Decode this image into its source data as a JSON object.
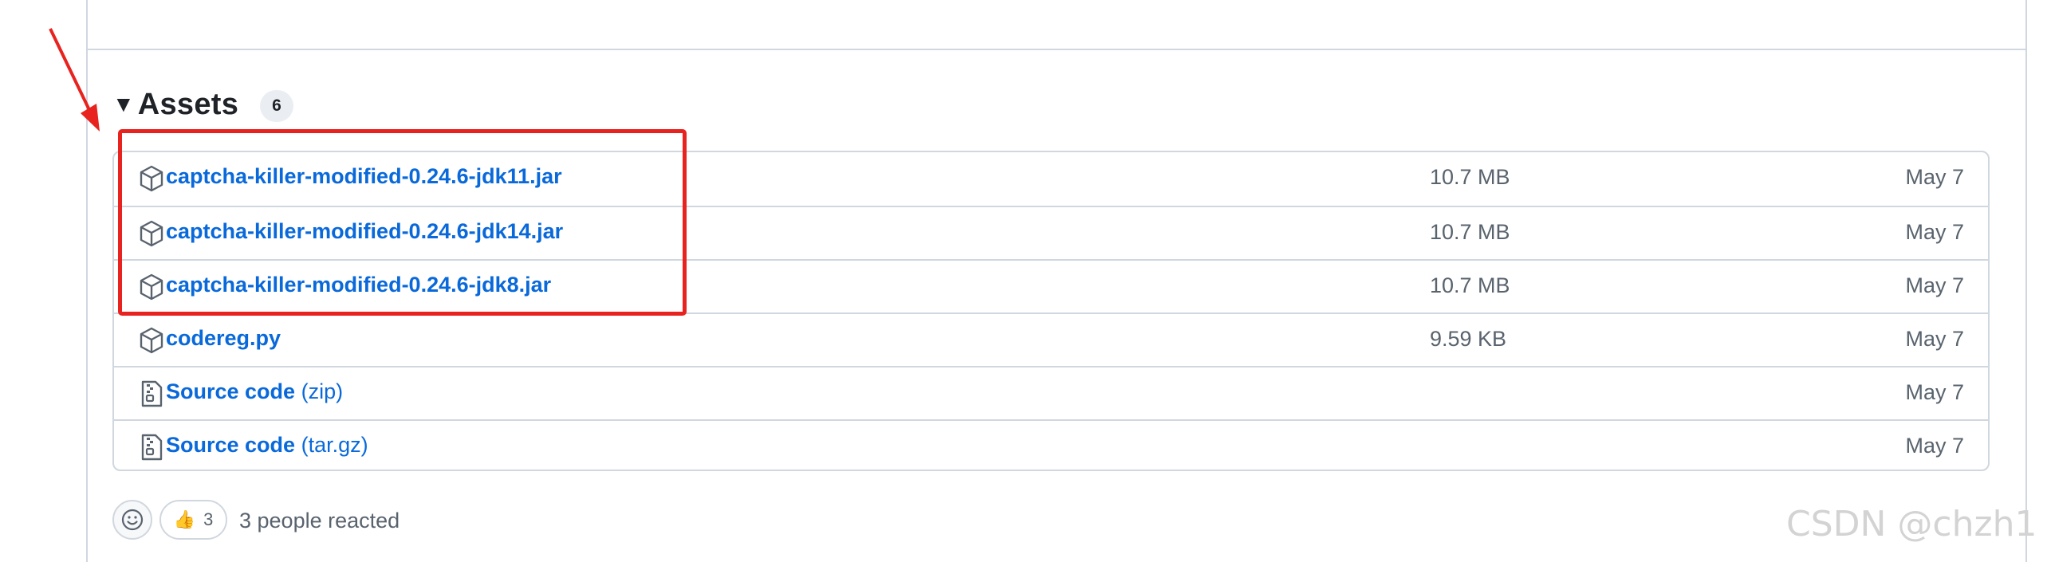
{
  "assets": {
    "title": "Assets",
    "count": "6",
    "items": [
      {
        "icon": "package-icon",
        "name": "captcha-killer-modified-0.24.6-jdk11.jar",
        "suffix": "",
        "size": "10.7 MB",
        "date": "May 7"
      },
      {
        "icon": "package-icon",
        "name": "captcha-killer-modified-0.24.6-jdk14.jar",
        "suffix": "",
        "size": "10.7 MB",
        "date": "May 7"
      },
      {
        "icon": "package-icon",
        "name": "captcha-killer-modified-0.24.6-jdk8.jar",
        "suffix": "",
        "size": "10.7 MB",
        "date": "May 7"
      },
      {
        "icon": "package-icon",
        "name": "codereg.py",
        "suffix": "",
        "size": "9.59 KB",
        "date": "May 7"
      },
      {
        "icon": "file-zip-icon",
        "name": "Source code",
        "suffix": "(zip)",
        "size": "",
        "date": "May 7"
      },
      {
        "icon": "file-zip-icon",
        "name": "Source code",
        "suffix": "(tar.gz)",
        "size": "",
        "date": "May 7"
      }
    ]
  },
  "reactions": {
    "thumbs_count": "3",
    "summary": "3 people reacted"
  },
  "watermark": "CSDN @chzh1",
  "colors": {
    "link": "#0969da",
    "annotation": "#e8231f",
    "border": "#d0d7de"
  }
}
